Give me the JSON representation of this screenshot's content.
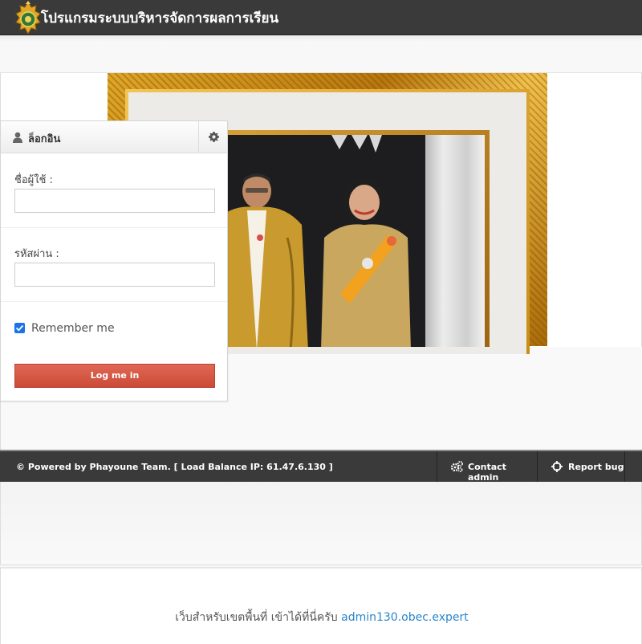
{
  "header": {
    "title": "โปรแกรมระบบบริหารจัดการผลการเรียน",
    "logo_icon": "school-emblem-icon"
  },
  "login": {
    "title": "ล็อกอิน",
    "user_icon": "user-icon",
    "settings_icon": "gear-icon",
    "username_label": "ชื่อผู้ใช้ :",
    "username_value": "",
    "password_label": "รหัสผ่าน :",
    "password_value": "",
    "remember_label": "Remember me",
    "remember_checked": true,
    "submit_label": "Log me in",
    "accent_color": "#d25a47"
  },
  "footer": {
    "powered_text": "© Powered by Phayoune Team. [ Load Balance IP: 61.47.6.130 ]",
    "contact_label": "Contact admin",
    "contact_icon": "cogs-icon",
    "report_label": "Report bug",
    "report_icon": "crosshairs-icon"
  },
  "notice": {
    "text": "เว็บสำหรับเขตพื้นที่ เข้าได้ที่นี่ครับ",
    "link_text": "admin130.obec.expert",
    "link_color": "#2a86c9"
  }
}
